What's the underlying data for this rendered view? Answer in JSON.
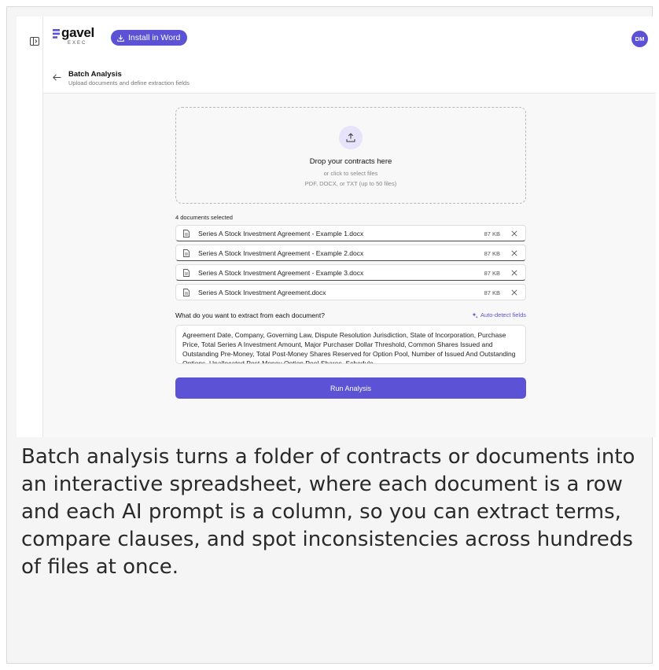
{
  "header": {
    "logo_word": "gavel",
    "logo_sub": "EXEC",
    "install_button_label": "Install in Word",
    "avatar_initials": "DM"
  },
  "subheader": {
    "title": "Batch Analysis",
    "subtitle": "Upload documents and define extraction fields"
  },
  "dropzone": {
    "title": "Drop your contracts here",
    "subtitle": "or click to select files",
    "file_types": "PDF, DOCX, or TXT (up to 50 files)"
  },
  "files": {
    "selected_label": "4 documents selected",
    "items": [
      {
        "name": "Series A Stock Investment Agreement - Example 1.docx",
        "size": "87 KB"
      },
      {
        "name": "Series A Stock Investment Agreement - Example 2.docx",
        "size": "87 KB"
      },
      {
        "name": "Series A Stock Investment Agreement - Example 3.docx",
        "size": "87 KB"
      },
      {
        "name": "Series A Stock Investment Agreement.docx",
        "size": "87 KB"
      }
    ]
  },
  "extraction": {
    "label": "What do you want to extract from each document?",
    "auto_detect_label": "Auto-detect fields",
    "fields_value": "Agreement Date, Company, Governing Law, Dispute Resolution Jurisdiction, State of Incorporation, Purchase Price, Total Series A Investment Amount, Major Purchaser Dollar Threshold, Common Shares Issued and Outstanding Pre-Money, Total Post-Money Shares Reserved for Option Pool, Number of Issued And Outstanding Options, Unallocated Post-Money Option Pool Shares, Schedule"
  },
  "run_button_label": "Run Analysis",
  "caption": "Batch analysis turns a folder of contracts or documents into an interactive spreadsheet, where each document is a row and each AI prompt is a column, so you can extract terms, compare clauses, and spot inconsistencies across hundreds of files at once.",
  "colors": {
    "accent": "#5b52d6",
    "accent_light": "#e6e3fb"
  },
  "icons": {
    "panel_toggle": "sidebar-toggle-icon",
    "download": "download-icon",
    "back": "arrow-left-icon",
    "upload": "upload-icon",
    "file": "document-icon",
    "remove": "close-icon",
    "sparkle": "sparkle-icon"
  }
}
